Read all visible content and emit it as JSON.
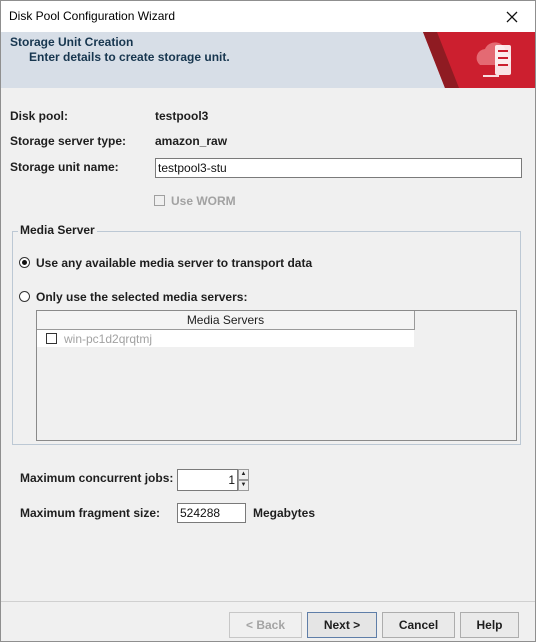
{
  "window": {
    "title": "Disk Pool Configuration Wizard"
  },
  "banner": {
    "title": "Storage Unit Creation",
    "subtitle": "Enter details to create storage unit."
  },
  "form": {
    "disk_pool_label": "Disk pool:",
    "disk_pool_value": "testpool3",
    "server_type_label": "Storage server type:",
    "server_type_value": "amazon_raw",
    "unit_name_label": "Storage unit name:",
    "unit_name_value": "testpool3-stu",
    "worm_label": "Use WORM"
  },
  "media_server": {
    "legend": "Media Server",
    "option_any": "Use any available media server to transport data",
    "option_selected": "Only use the selected media servers:",
    "column_header": "Media Servers",
    "servers": [
      {
        "name": "win-pc1d2qrqtmj",
        "checked": false
      }
    ]
  },
  "limits": {
    "max_jobs_label": "Maximum concurrent jobs:",
    "max_jobs_value": "1",
    "max_fragment_label": "Maximum fragment size:",
    "max_fragment_value": "524288",
    "fragment_unit": "Megabytes"
  },
  "buttons": {
    "back": "< Back",
    "next": "Next >",
    "cancel": "Cancel",
    "help": "Help"
  },
  "colors": {
    "banner_bg": "#d7dee7",
    "logo_red": "#cc1f2f",
    "title_text": "#17364f"
  },
  "icons": {
    "close": "close-icon",
    "logo": "storage-cloud-icon"
  }
}
